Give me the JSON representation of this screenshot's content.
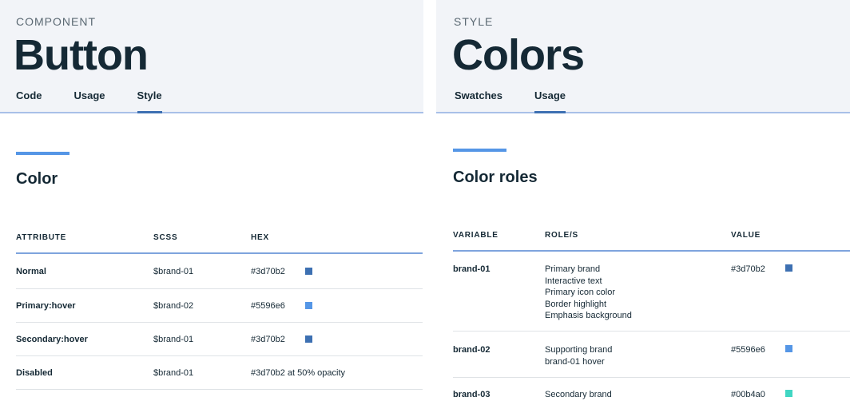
{
  "button_page": {
    "eyebrow": "COMPONENT",
    "title": "Button",
    "tabs": [
      {
        "label": "Code",
        "active": false
      },
      {
        "label": "Usage",
        "active": false
      },
      {
        "label": "Style",
        "active": true
      }
    ],
    "section_title": "Color",
    "table": {
      "headers": [
        "ATTRIBUTE",
        "SCSS",
        "HEX"
      ],
      "rows": [
        {
          "attribute": "Normal",
          "scss": "$brand-01",
          "hex": "#3d70b2",
          "swatch": "#3d70b2"
        },
        {
          "attribute": "Primary:hover",
          "scss": "$brand-02",
          "hex": "#5596e6",
          "swatch": "#5596e6"
        },
        {
          "attribute": "Secondary:hover",
          "scss": "$brand-01",
          "hex": "#3d70b2",
          "swatch": "#3d70b2"
        },
        {
          "attribute": "Disabled",
          "scss": "$brand-01",
          "hex": "#3d70b2 at 50% opacity"
        }
      ]
    }
  },
  "colors_page": {
    "eyebrow": "STYLE",
    "title": "Colors",
    "tabs": [
      {
        "label": "Swatches",
        "active": false
      },
      {
        "label": "Usage",
        "active": true
      }
    ],
    "section_title": "Color roles",
    "table": {
      "headers": [
        "VARIABLE",
        "ROLE/S",
        "VALUE"
      ],
      "rows": [
        {
          "variable": "brand-01",
          "roles": [
            "Primary brand",
            "Interactive text",
            "Primary icon color",
            "Border highlight",
            "Emphasis background"
          ],
          "value": "#3d70b2",
          "swatch": "#3d70b2"
        },
        {
          "variable": "brand-02",
          "roles": [
            "Supporting brand",
            "brand-01 hover"
          ],
          "value": "#5596e6",
          "swatch": "#5596e6"
        },
        {
          "variable": "brand-03",
          "roles": [
            "Secondary brand"
          ],
          "value": "#00b4a0",
          "swatch": "#41d6c3"
        }
      ]
    }
  },
  "colors": {
    "hero_bg": "#f2f4f8",
    "text": "#152935",
    "accent": "#5596e6",
    "tab_indicator": "#3d70b2"
  }
}
